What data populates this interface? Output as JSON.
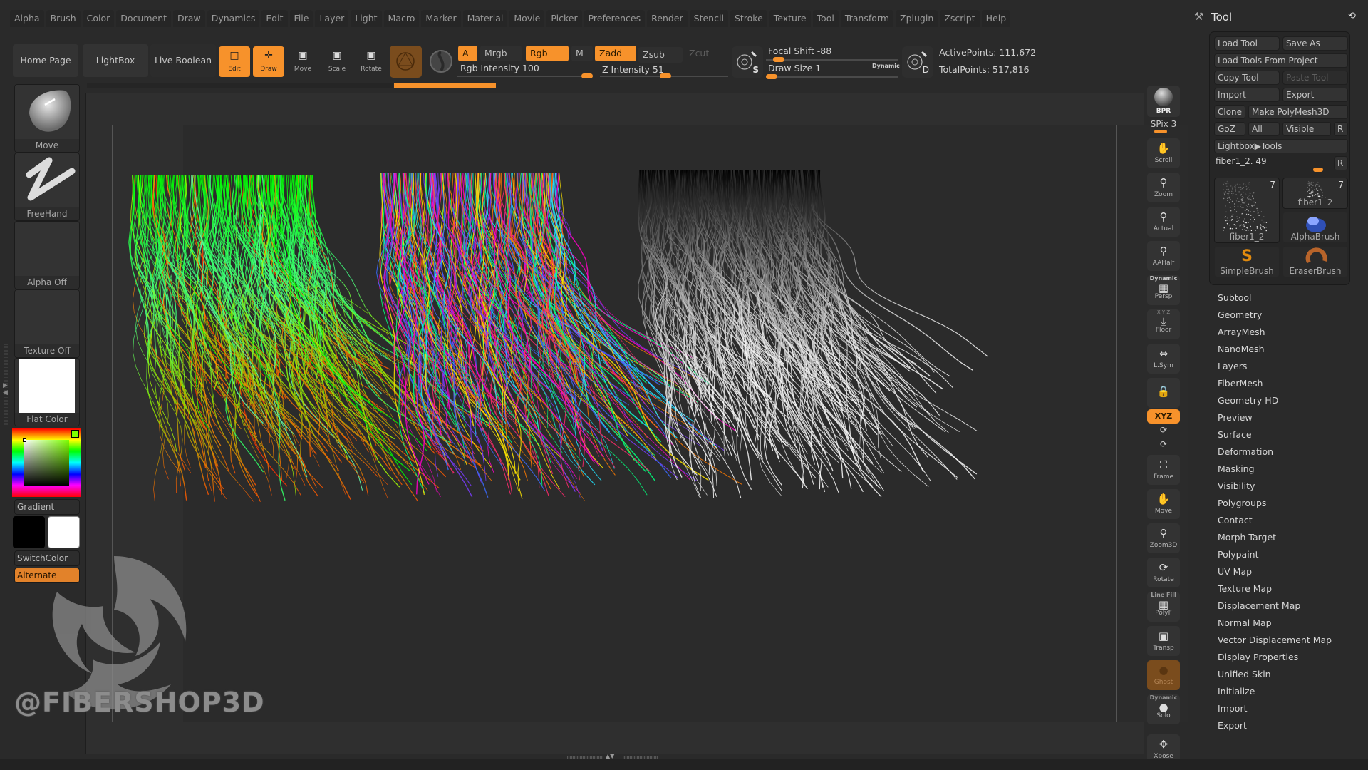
{
  "menu": [
    "Alpha",
    "Brush",
    "Color",
    "Document",
    "Draw",
    "Dynamics",
    "Edit",
    "File",
    "Layer",
    "Light",
    "Macro",
    "Marker",
    "Material",
    "Movie",
    "Picker",
    "Preferences",
    "Render",
    "Stencil",
    "Stroke",
    "Texture",
    "Tool",
    "Transform",
    "Zplugin",
    "Zscript",
    "Help"
  ],
  "toolbar": {
    "home_page": "Home Page",
    "lightbox": "LightBox",
    "live_boolean": "Live Boolean",
    "edit": "Edit",
    "draw": "Draw",
    "move": "Move",
    "scale": "Scale",
    "rotate": "Rotate",
    "a_label": "A",
    "mrgb": "Mrgb",
    "rgb": "Rgb",
    "m": "M",
    "zadd": "Zadd",
    "zsub": "Zsub",
    "zcut": "Zcut",
    "rgb_intensity_label": "Rgb Intensity 100",
    "rgb_intensity": 100,
    "z_intensity_label": "Z Intensity 51",
    "z_intensity": 51,
    "focal_shift_label": "Focal Shift -88",
    "focal_shift": -88,
    "draw_size_label": "Draw Size 1",
    "draw_size": 1,
    "dynamic": "Dynamic",
    "s_label": "S",
    "d_label": "D",
    "active_points": "ActivePoints: 111,672",
    "total_points": "TotalPoints: 517,816"
  },
  "left_shelf": {
    "brush": "Move",
    "stroke": "FreeHand",
    "alpha": "Alpha Off",
    "texture": "Texture Off",
    "material": "Flat Color",
    "gradient": "Gradient",
    "switch_color": "SwitchColor",
    "alternate": "Alternate",
    "main_color": "#000000",
    "secondary_color": "#ffffff",
    "picker_hue": "#7cff00"
  },
  "right_shelf": {
    "bpr": "BPR",
    "spix": "SPix 3",
    "scroll": "Scroll",
    "zoom": "Zoom",
    "actual": "Actual",
    "aahalf": "AAHalf",
    "persp_dynamic": "Dynamic",
    "persp": "Persp",
    "floor_axes": "X Y Z",
    "floor": "Floor",
    "lsym": "L.Sym",
    "xyz": "XYZ",
    "frame": "Frame",
    "move": "Move",
    "zoom3d": "Zoom3D",
    "rotate": "Rotate",
    "linefill": "Line Fill",
    "polyf": "PolyF",
    "transp": "Transp",
    "ghost": "Ghost",
    "solo_dynamic": "Dynamic",
    "solo": "Solo",
    "xpose": "Xpose"
  },
  "tool_palette": {
    "title": "Tool",
    "load_tool": "Load Tool",
    "save_as": "Save As",
    "load_tools_from_project": "Load Tools From Project",
    "copy_tool": "Copy Tool",
    "paste_tool": "Paste Tool",
    "import": "Import",
    "export": "Export",
    "clone": "Clone",
    "make_polymesh": "Make PolyMesh3D",
    "goz": "GoZ",
    "all": "All",
    "visible": "Visible",
    "r": "R",
    "lightbox_tools": "Lightbox▶Tools",
    "current_tool": "fiber1_2. 49",
    "tools": [
      {
        "name": "fiber1_2",
        "count": "7"
      },
      {
        "name": "fiber1_2",
        "count": "7"
      },
      {
        "name": "AlphaBrush",
        "count": ""
      },
      {
        "name": "SimpleBrush",
        "count": ""
      },
      {
        "name": "EraserBrush",
        "count": ""
      }
    ],
    "subpalettes": [
      "Subtool",
      "Geometry",
      "ArrayMesh",
      "NanoMesh",
      "Layers",
      "FiberMesh",
      "Geometry HD",
      "Preview",
      "Surface",
      "Deformation",
      "Masking",
      "Visibility",
      "Polygroups",
      "Contact",
      "Morph Target",
      "Polypaint",
      "UV Map",
      "Texture Map",
      "Displacement Map",
      "Normal Map",
      "Vector Displacement Map",
      "Display Properties",
      "Unified Skin",
      "Initialize",
      "Import",
      "Export"
    ]
  },
  "canvas": {
    "hair_groups": [
      {
        "name": "green-gradient-fibers",
        "palette": [
          "#00ff00",
          "#33ff66",
          "#66ffaa",
          "#aaff00",
          "#ff8800",
          "#ff3300"
        ]
      },
      {
        "name": "random-color-fibers",
        "palette": [
          "#ff2a6d",
          "#20e3ff",
          "#ffe600",
          "#7a3cff",
          "#00ff7b",
          "#ff7b00",
          "#3b6bff",
          "#ff00c8"
        ]
      },
      {
        "name": "grayscale-fibers",
        "palette": [
          "#ffffff",
          "#dddddd",
          "#bbbbbb",
          "#999999"
        ]
      }
    ]
  },
  "watermark": "@FIBERSHOP3D"
}
